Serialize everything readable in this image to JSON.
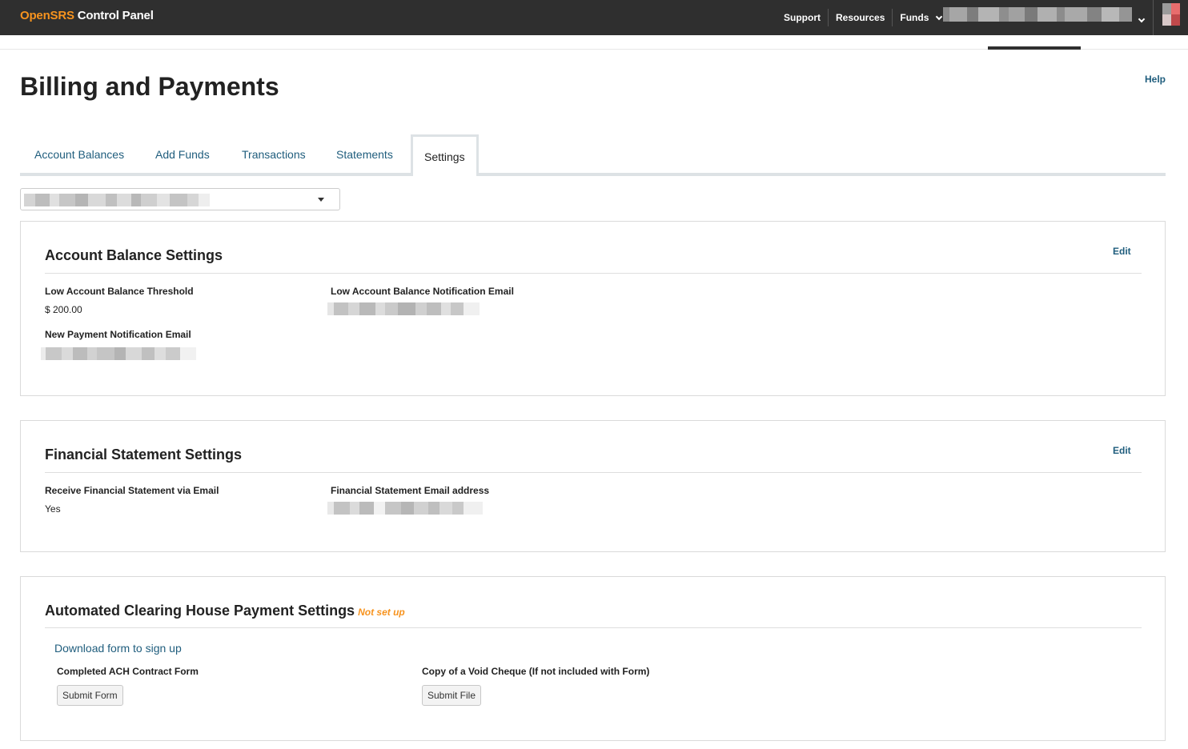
{
  "topbar": {
    "brand_first": "OpenSRS",
    "brand_second": " Control Panel",
    "nav": [
      "Support",
      "Resources",
      "Funds"
    ],
    "avatar_colors": [
      "#e86d6d",
      "#c0494b",
      "#9b9b9b",
      "#d8c8c8"
    ]
  },
  "page": {
    "title": "Billing and Payments",
    "help": "Help"
  },
  "tabs": [
    {
      "label": "Account Balances"
    },
    {
      "label": "Add Funds"
    },
    {
      "label": "Transactions"
    },
    {
      "label": "Statements"
    },
    {
      "label": "Settings"
    }
  ],
  "account_balance": {
    "title": "Account Balance Settings",
    "edit": "Edit",
    "threshold_label": "Low Account Balance Threshold",
    "threshold_value": "$ 200.00",
    "low_email_label": "Low Account Balance Notification Email",
    "new_payment_label": "New Payment Notification Email"
  },
  "financial": {
    "title": "Financial Statement Settings",
    "edit": "Edit",
    "receive_label": "Receive Financial Statement via Email",
    "receive_value": "Yes",
    "email_label": "Financial Statement Email address"
  },
  "ach": {
    "title": "Automated Clearing House Payment Settings",
    "status": "Not set up",
    "download_link": "Download form to sign up",
    "contract_label": "Completed ACH Contract Form",
    "contract_button": "Submit Form",
    "cheque_label": "Copy of a Void Cheque (If not included with Form)",
    "cheque_button": "Submit File"
  },
  "colors": {
    "brand_orange": "#f7931e",
    "link_blue": "#1f5d7d",
    "topbar_bg": "#2f2f2f"
  }
}
